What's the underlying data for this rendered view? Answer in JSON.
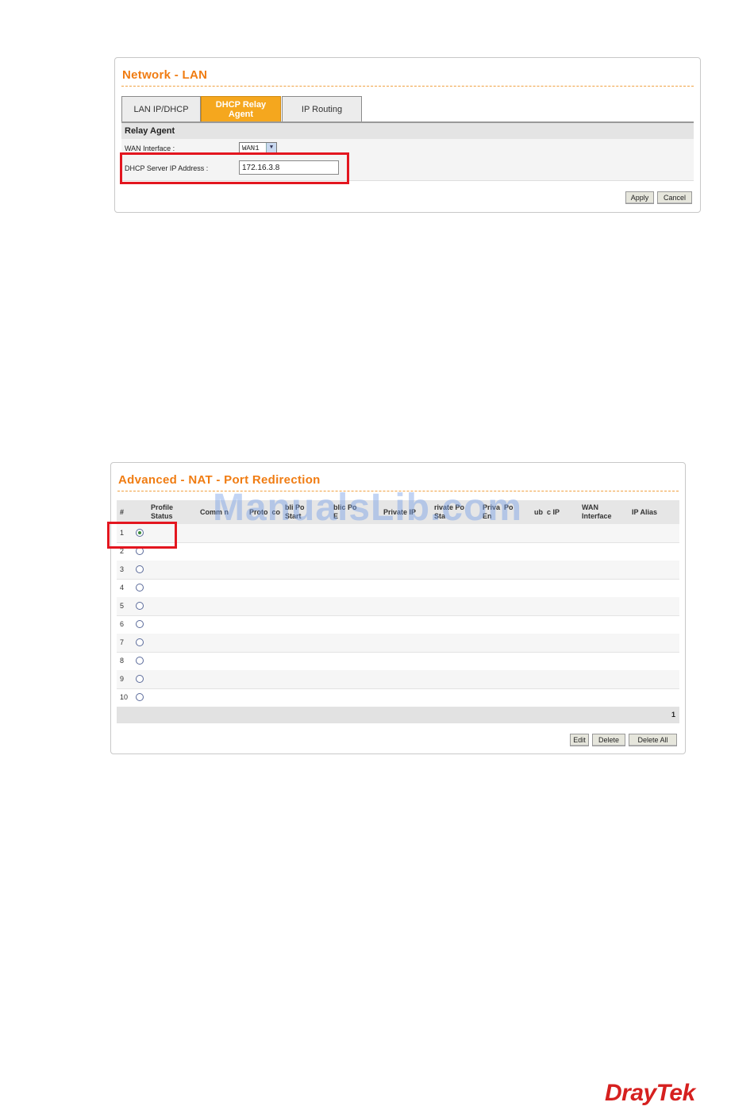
{
  "panel1": {
    "title": "Network - LAN",
    "tabs": [
      {
        "label": "LAN IP/DHCP",
        "active": false
      },
      {
        "label": "DHCP Relay Agent",
        "active": true
      },
      {
        "label": "IP Routing",
        "active": false
      }
    ],
    "section_title": "Relay Agent",
    "wan_label": "WAN Interface :",
    "wan_value": "WAN1",
    "dhcp_label": "DHCP Server IP Address :",
    "dhcp_value": "172.16.3.8",
    "apply_label": "Apply",
    "cancel_label": "Cancel"
  },
  "panel2": {
    "title": "Advanced - NAT - Port Redirection",
    "columns": [
      "#",
      "Profile Status",
      "Comm...",
      "Protocol",
      "Public Port Start",
      "Public Port End",
      "Private IP",
      "Private Port Start",
      "Private Port End",
      "Public IP",
      "WAN Interface",
      "IP Alias"
    ],
    "header_visible": {
      "num": "#",
      "status": "Profile\nStatus",
      "comment": "Comm n",
      "protocol": "Proto  co",
      "pub_start": "bli Po\nStart",
      "pub_end": "blic Po\nE",
      "private_ip": "Private IP",
      "priv_start": "rivate Po\nSta",
      "priv_end": "Priva  Po\nEn",
      "public_ip": "ub  c IP",
      "wan": "WAN\nInterface",
      "alias": "IP Alias"
    },
    "rows": [
      {
        "num": "1",
        "selected": true
      },
      {
        "num": "2",
        "selected": false
      },
      {
        "num": "3",
        "selected": false
      },
      {
        "num": "4",
        "selected": false
      },
      {
        "num": "5",
        "selected": false
      },
      {
        "num": "6",
        "selected": false
      },
      {
        "num": "7",
        "selected": false
      },
      {
        "num": "8",
        "selected": false
      },
      {
        "num": "9",
        "selected": false
      },
      {
        "num": "10",
        "selected": false
      }
    ],
    "page": "1",
    "edit_label": "Edit",
    "delete_label": "Delete",
    "delete_all_label": "Delete All"
  },
  "watermark": "ManualsLib.com",
  "logo": "DrayTek",
  "colors": {
    "accent": "#f07c12",
    "tab_active": "#f5a71e",
    "highlight": "#e3161f",
    "logo": "#d6201f"
  }
}
